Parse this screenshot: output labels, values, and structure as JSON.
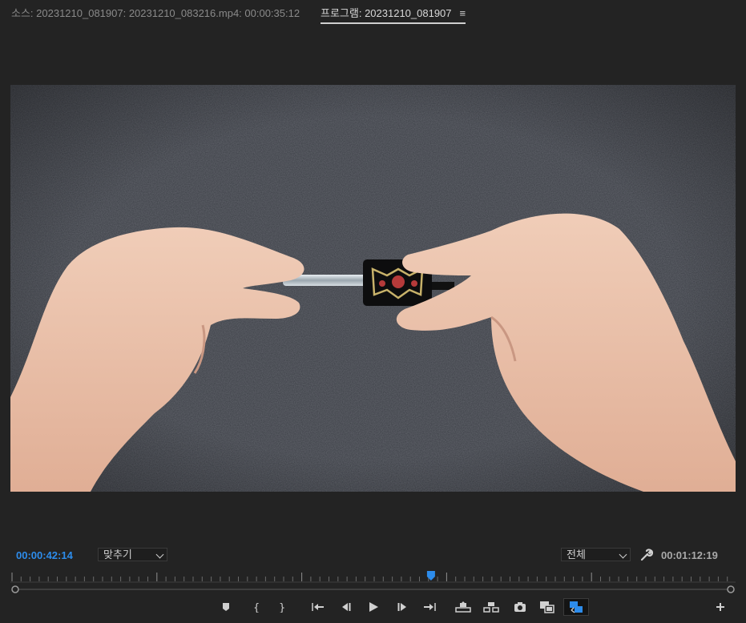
{
  "tabs": {
    "source": "소스: 20231210_081907: 20231210_083216.mp4: 00:00:35:12",
    "program": "프로그램: 20231210_081907",
    "program_menu": "≡"
  },
  "timecode": {
    "current": "00:00:42:14",
    "duration": "00:01:12:19"
  },
  "zoom": {
    "selected": "맞추기"
  },
  "resolution": {
    "selected": "전체"
  },
  "playhead": {
    "fraction": 0.58
  },
  "colors": {
    "accent": "#2d8ceb",
    "background": "#232323"
  },
  "controls": [
    {
      "name": "add-marker-icon"
    },
    {
      "name": "mark-in-icon"
    },
    {
      "name": "mark-out-icon"
    },
    {
      "name": "go-to-in-icon"
    },
    {
      "name": "step-back-icon"
    },
    {
      "name": "play-icon"
    },
    {
      "name": "step-forward-icon"
    },
    {
      "name": "go-to-out-icon"
    },
    {
      "name": "lift-icon"
    },
    {
      "name": "extract-icon"
    },
    {
      "name": "export-frame-icon"
    },
    {
      "name": "compare-view-icon"
    },
    {
      "name": "proxy-toggle-icon"
    },
    {
      "name": "add-button-icon"
    }
  ]
}
